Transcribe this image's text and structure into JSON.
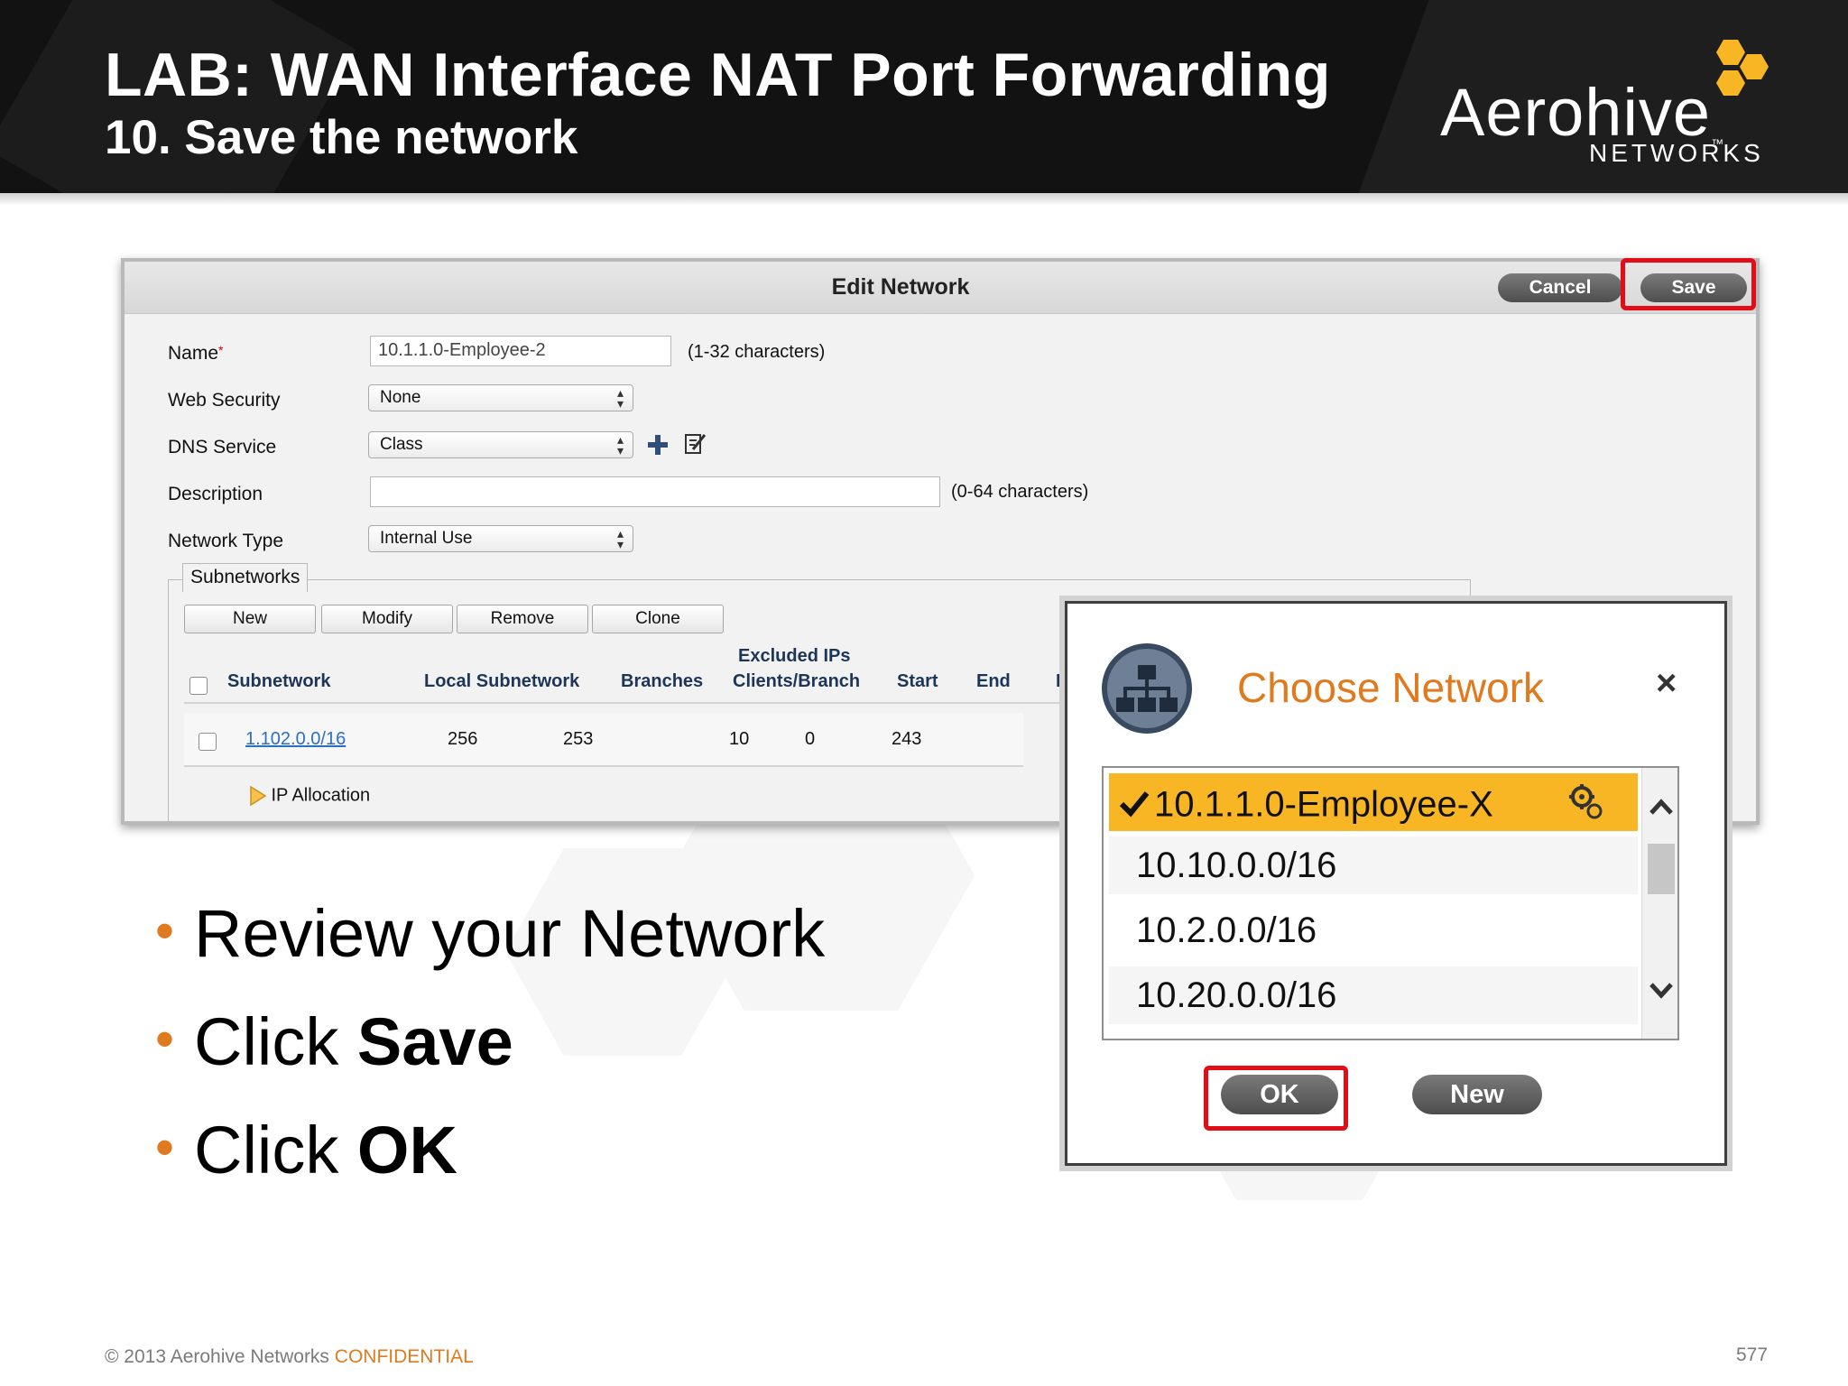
{
  "slide": {
    "title": "LAB: WAN Interface NAT Port Forwarding",
    "subtitle": "10. Save the network",
    "logo": {
      "word": "Aerohive",
      "tm": "™",
      "sub": "NETWORKS"
    },
    "footer": {
      "copyright": "© 2013 Aerohive Networks",
      "confidential": "CONFIDENTIAL",
      "page_number": "577"
    },
    "accent_color": "#e07a1f"
  },
  "edit_network": {
    "title": "Edit Network",
    "cancel_label": "Cancel",
    "save_label": "Save",
    "fields": {
      "name_label": "Name",
      "name_required": "*",
      "name_value": "10.1.1.0-Employee-2",
      "name_hint": "(1-32 characters)",
      "web_security_label": "Web Security",
      "web_security_value": "None",
      "dns_service_label": "DNS Service",
      "dns_service_value": "Class",
      "description_label": "Description",
      "description_value": "",
      "description_hint": "(0-64 characters)",
      "network_type_label": "Network Type",
      "network_type_value": "Internal Use"
    },
    "subnetworks": {
      "legend": "Subnetworks",
      "buttons": [
        "New",
        "Modify",
        "Remove",
        "Clone"
      ],
      "columns": {
        "subnetwork": "Subnetwork",
        "local_subnetwork": "Local Subnetwork",
        "branches": "Branches",
        "excluded_top": "Excluded IPs",
        "excluded_bottom": "Clients/Branch",
        "start": "Start",
        "end": "End",
        "ip": "IP"
      },
      "rows": [
        {
          "subnetwork": "1.102.0.0/16",
          "local_subnetwork": "256",
          "branches": "253",
          "excluded": "10",
          "clients": "0",
          "start": "243"
        }
      ],
      "ip_allocation": "IP Allocation"
    }
  },
  "bullets": {
    "b1": "Review your Network",
    "b2_prefix": "Click ",
    "b2_bold": "Save",
    "b3_prefix": "Click ",
    "b3_bold": "OK"
  },
  "choose_network": {
    "title": "Choose Network",
    "close": "×",
    "items": [
      "10.1.1.0-Employee-X",
      "10.10.0.0/16",
      "10.2.0.0/16",
      "10.20.0.0/16"
    ],
    "selected_index": 0,
    "selected_color": "#f8b624",
    "ok_label": "OK",
    "new_label": "New"
  },
  "highlight_color": "#e30d17"
}
